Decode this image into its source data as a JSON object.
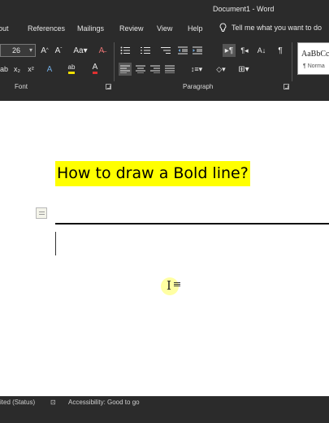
{
  "window": {
    "title": "Document1 - Word"
  },
  "tabs": [
    "out",
    "References",
    "Mailings",
    "Review",
    "View",
    "Help"
  ],
  "tell_me": {
    "label": "Tell me what you want to do"
  },
  "font": {
    "size": "26",
    "group_label": "Font"
  },
  "paragraph": {
    "group_label": "Paragraph"
  },
  "styles": {
    "preview": "AaBbCc",
    "normal_label": "¶ Norma"
  },
  "document": {
    "heading_text": "How to draw a Bold line?"
  },
  "status": {
    "left_text": "ited (Status)",
    "accessibility_text": "Accessibility: Good to go"
  },
  "colors": {
    "ribbon": "#2b2b2b",
    "highlight": "#ffff00",
    "font_color": "#e03030",
    "text_highlight": "#f0e000"
  },
  "icons": [
    "grow-font-icon",
    "shrink-font-icon",
    "change-case-icon",
    "clear-formatting-icon",
    "subscript-icon",
    "superscript-icon",
    "text-effects-icon",
    "highlight-icon",
    "font-color-icon",
    "bullets-icon",
    "numbering-icon",
    "multilevel-list-icon",
    "decrease-indent-icon",
    "increase-indent-icon",
    "ltr-icon",
    "rtl-icon",
    "sort-icon",
    "show-marks-icon",
    "align-left-icon",
    "center-icon",
    "align-right-icon",
    "justify-icon",
    "line-spacing-icon",
    "shading-icon",
    "borders-icon",
    "lightbulb-icon",
    "paste-options-icon",
    "ibeam-cursor-icon"
  ]
}
